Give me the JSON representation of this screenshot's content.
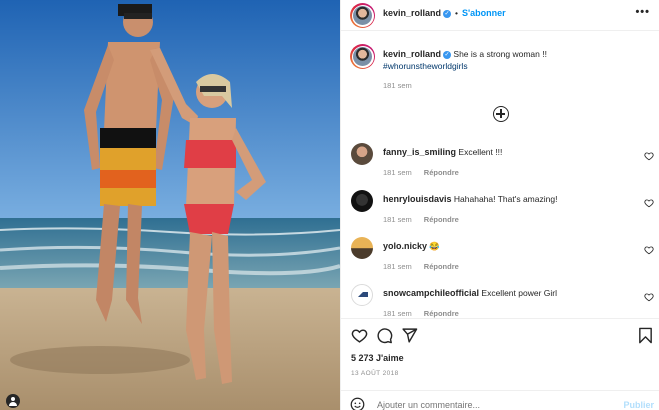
{
  "post": {
    "author": "kevin_rolland",
    "separator": "•",
    "follow_label": "S'abonner",
    "more_label": "•••",
    "caption_text": "She is a strong woman !!",
    "hashtag": "#whorunstheworldgirls",
    "caption_time": "181 sem"
  },
  "comments": [
    {
      "user": "fanny_is_smiling",
      "text": "Excellent !!!",
      "time": "181 sem",
      "reply": "Répondre"
    },
    {
      "user": "henrylouisdavis",
      "text": "Hahahaha! That's amazing!",
      "time": "181 sem",
      "reply": "Répondre"
    },
    {
      "user": "yolo.nicky",
      "text": "😂",
      "time": "181 sem",
      "reply": "Répondre"
    },
    {
      "user": "snowcampchileofficial",
      "text": "Excellent power Girl",
      "time": "181 sem",
      "reply": "Répondre"
    }
  ],
  "actions": {
    "likes": "5 273 J'aime",
    "date": "13 AOÛT 2018"
  },
  "composer": {
    "placeholder": "Ajouter un commentaire...",
    "publish_label": "Publier"
  },
  "icons": {
    "more": "more-options-icon",
    "load_more": "plus-circle-icon",
    "like": "heart-icon",
    "comment": "comment-icon",
    "share": "share-icon",
    "save": "bookmark-icon",
    "emoji": "emoji-icon"
  },
  "colors": {
    "link_blue": "#0095f6",
    "hashtag": "#00376b",
    "muted": "#8e8e8e",
    "verified": "#3897f0"
  }
}
